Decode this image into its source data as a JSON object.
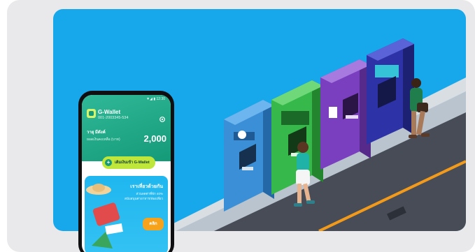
{
  "wallet": {
    "status_time": "▼◢ ▮ 12:30",
    "title": "G-Wallet",
    "number": "001-2003345-534",
    "user_name": "วายุ มีตังค์",
    "balance_label": "ยอดเงินคงเหลือ (บาท)",
    "balance": "2,000",
    "topup_label": "เติมเงินเข้า G-Wallet",
    "topup_icon": "plus-icon",
    "settings_icon": "gear-icon"
  },
  "promo": {
    "title": "เราเที่ยวด้วยกัน",
    "line1": "ส่วนลดค่าที่พัก 40%",
    "line2": "สนับสนุนค่าอาหาร/ท่องเที่ยว",
    "button": "คลิก"
  },
  "colors": {
    "sky": "#16a8ea",
    "wallet_green": "#159a78",
    "lime": "#bfe63a",
    "orange": "#f7a21b"
  }
}
